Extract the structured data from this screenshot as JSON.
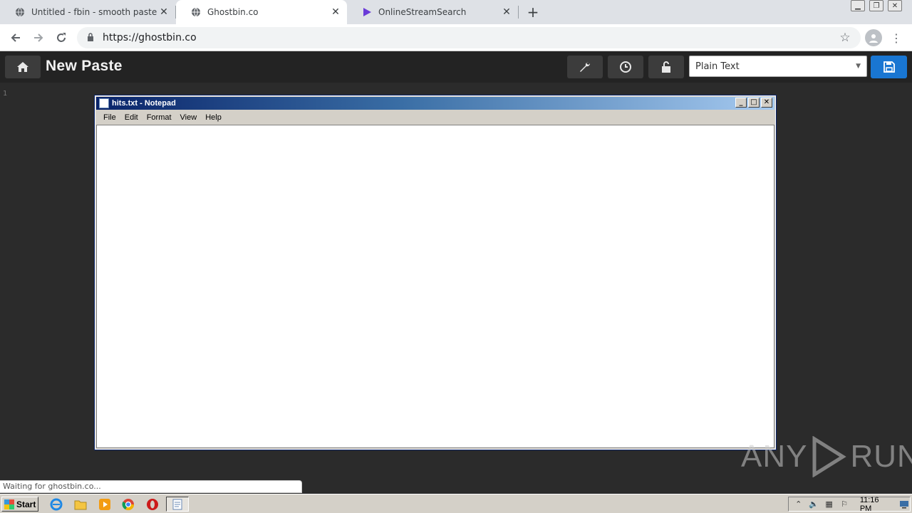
{
  "browser": {
    "tabs": [
      {
        "label": "Untitled - fbin - smooth pastes",
        "icon": "globe-icon",
        "active": false
      },
      {
        "label": "Ghostbin.co",
        "icon": "globe-icon",
        "active": true
      },
      {
        "label": "OnlineStreamSearch",
        "icon": "play-logo-icon",
        "active": false
      }
    ],
    "new_tab_label": "+",
    "url": "https://ghostbin.co"
  },
  "app": {
    "title": "New Paste",
    "language_selected": "Plain Text",
    "line_numbers": [
      "1"
    ],
    "accent_color": "#1976d2"
  },
  "notepad": {
    "title": "hits.txt - Notepad",
    "menu": [
      "File",
      "Edit",
      "Format",
      "View",
      "Help"
    ]
  },
  "status_text": "Waiting for ghostbin.co...",
  "watermark": {
    "left": "ANY",
    "right": "RUN"
  },
  "taskbar": {
    "start_label": "Start",
    "clock": "11:16 PM"
  }
}
